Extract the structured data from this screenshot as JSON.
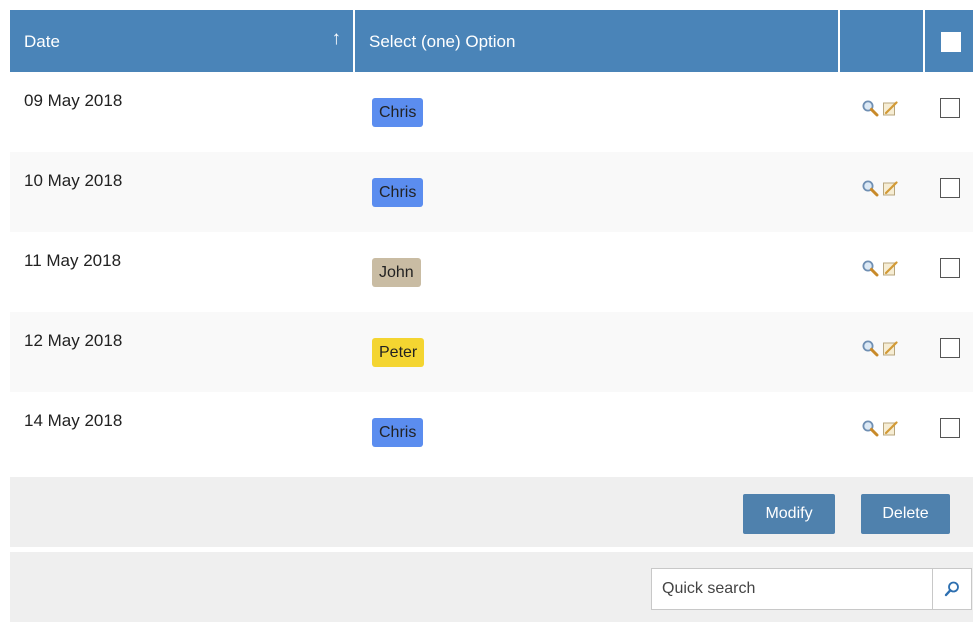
{
  "table": {
    "columns": {
      "date": "Date",
      "option": "Select (one) Option"
    },
    "sort_indicator": "↑",
    "rows": [
      {
        "date": "09 May 2018",
        "option": "Chris",
        "badge_color": "#5b8def"
      },
      {
        "date": "10 May 2018",
        "option": "Chris",
        "badge_color": "#5b8def"
      },
      {
        "date": "11 May 2018",
        "option": "John",
        "badge_color": "#c9bca3"
      },
      {
        "date": "12 May 2018",
        "option": "Peter",
        "badge_color": "#f4d531"
      },
      {
        "date": "14 May 2018",
        "option": "Chris",
        "badge_color": "#5b8def"
      }
    ],
    "row_icons": [
      "magnifier-icon",
      "edit-note-icon"
    ]
  },
  "actions": {
    "modify_label": "Modify",
    "delete_label": "Delete"
  },
  "search": {
    "placeholder": "Quick search",
    "icon": "search-icon"
  },
  "colors": {
    "header_bg": "#4a84b8",
    "button_bg": "#4f81ad",
    "footer_bg": "#efefef"
  }
}
